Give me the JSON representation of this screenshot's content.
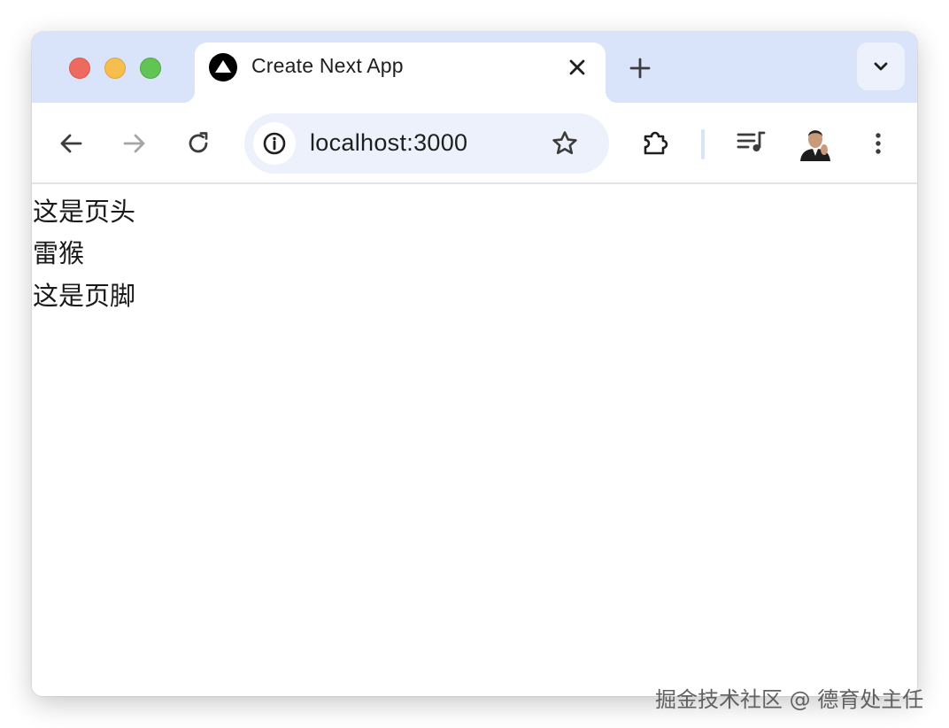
{
  "window": {
    "traffic_lights": [
      "close",
      "minimize",
      "maximize"
    ]
  },
  "tab": {
    "title": "Create Next App",
    "favicon": "nextjs-triangle-icon"
  },
  "toolbar": {
    "url": "localhost:3000",
    "icons": [
      "back-icon",
      "forward-icon",
      "reload-icon",
      "site-info-icon",
      "bookmark-star-icon",
      "extensions-icon",
      "media-control-icon",
      "avatar",
      "menu-icon"
    ]
  },
  "page": {
    "header": "这是页头",
    "body": "雷猴",
    "footer": "这是页脚"
  },
  "watermark": "掘金技术社区 @ 德育处主任"
}
